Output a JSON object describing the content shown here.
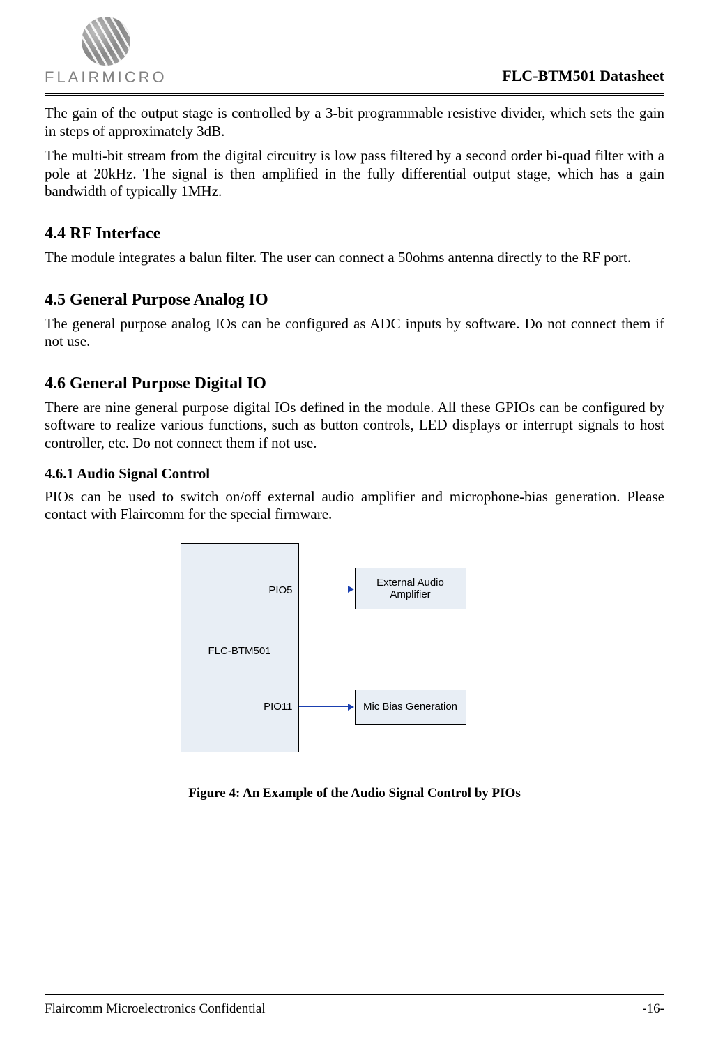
{
  "header": {
    "brand": "FLAIRMICRO",
    "doc_title": "FLC-BTM501 Datasheet"
  },
  "intro": {
    "p1": "The gain of the output stage is controlled by a 3-bit programmable resistive divider, which sets the gain in steps of approximately 3dB.",
    "p2": "The multi-bit stream from the digital circuitry is low pass filtered by a second order bi-quad filter with a pole at 20kHz. The signal is then amplified in the fully differential output stage, which has a gain bandwidth of typically 1MHz."
  },
  "s44": {
    "heading": "4.4  RF Interface",
    "p1": "The module integrates a balun filter. The user can connect a 50ohms antenna directly to the RF port."
  },
  "s45": {
    "heading": "4.5  General Purpose Analog IO",
    "p1": "The general purpose analog IOs can be configured as ADC inputs by software. Do not connect them if not use."
  },
  "s46": {
    "heading": "4.6  General Purpose Digital IO",
    "p1": "There are nine general purpose digital IOs defined in the module. All these GPIOs can be configured by software to realize various functions, such as button controls, LED displays or interrupt signals to host controller, etc. Do not connect them if not use."
  },
  "s461": {
    "heading": "4.6.1   Audio Signal Control",
    "p1": "PIOs can be used to switch on/off external audio amplifier and microphone-bias generation. Please contact with Flaircomm for the special firmware."
  },
  "figure": {
    "main_label": "FLC-BTM501",
    "pio5": "PIO5",
    "pio11": "PIO11",
    "amp": "External Audio Amplifier",
    "mic": "Mic Bias Generation",
    "caption": "Figure 4: An Example of the Audio Signal Control by PIOs"
  },
  "footer": {
    "left": "Flaircomm Microelectronics Confidential",
    "right": "-16-"
  }
}
